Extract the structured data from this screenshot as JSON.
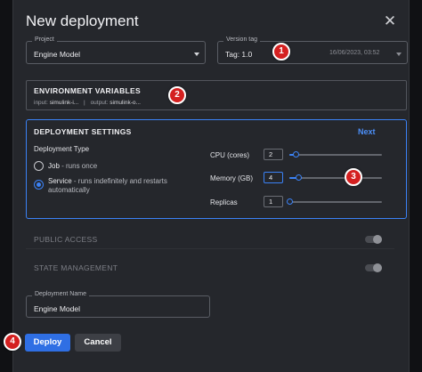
{
  "dialog": {
    "title": "New deployment",
    "close_glyph": "✕"
  },
  "project": {
    "label": "Project",
    "value": "Engine Model"
  },
  "version_tag": {
    "label": "Version tag",
    "value": "Tag: 1.0",
    "date": "16/06/2023, 03:52"
  },
  "env_vars": {
    "title": "ENVIRONMENT VARIABLES",
    "input_key": "input:",
    "input_value": "simulink-i...",
    "separator": "|",
    "output_key": "output:",
    "output_value": "simulink-o..."
  },
  "deployment_settings": {
    "title": "DEPLOYMENT SETTINGS",
    "next_label": "Next",
    "type_label": "Deployment Type",
    "options": [
      {
        "name": "Job",
        "description": " - runs once",
        "selected": false
      },
      {
        "name": "Service",
        "description": " - runs indefinitely and restarts automatically",
        "selected": true
      }
    ],
    "resources": [
      {
        "label": "CPU (cores)",
        "value": "2",
        "min": 1,
        "max": 16,
        "fraction": 0.07
      },
      {
        "label": "Memory (GB)",
        "value": "4",
        "min": 1,
        "max": 32,
        "fraction": 0.1
      },
      {
        "label": "Replicas",
        "value": "1",
        "min": 1,
        "max": 10,
        "fraction": 0.0
      }
    ]
  },
  "public_access": {
    "label": "PUBLIC ACCESS",
    "enabled": false
  },
  "state_management": {
    "label": "STATE MANAGEMENT",
    "enabled": false
  },
  "deployment_name": {
    "label": "Deployment Name",
    "value": "Engine Model"
  },
  "actions": {
    "deploy_label": "Deploy",
    "cancel_label": "Cancel"
  },
  "annotations": [
    "1",
    "2",
    "3",
    "4"
  ],
  "colors": {
    "accent": "#3b82f6",
    "badge": "#d42020",
    "dialog_bg": "#25272c"
  }
}
